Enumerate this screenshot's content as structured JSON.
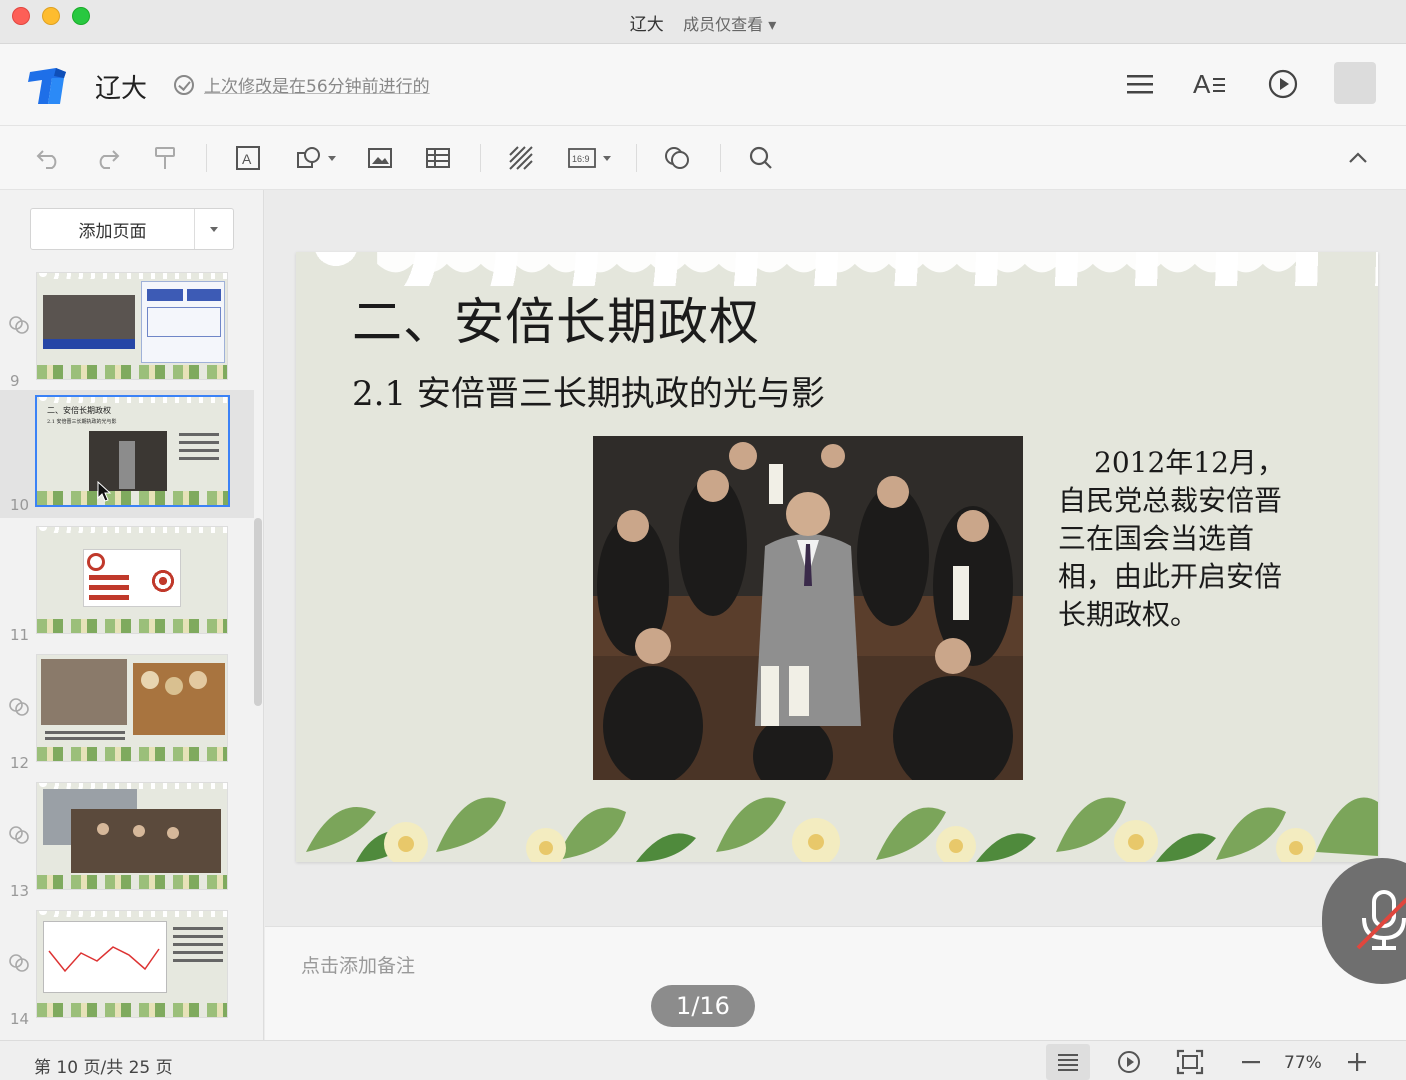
{
  "window": {
    "title": "辽大",
    "permission": "成员仅查看"
  },
  "header": {
    "doc_title": "辽大",
    "saved_status": "上次修改是在56分钟前进行的"
  },
  "sidebar": {
    "add_page": "添加页面",
    "thumbnails": [
      {
        "number": "9",
        "title": ""
      },
      {
        "number": "10",
        "title": "二、安倍长期政权",
        "subtitle": "2.1 安倍晋三长期执政的光与影"
      },
      {
        "number": "11",
        "title": ""
      },
      {
        "number": "12",
        "title": ""
      },
      {
        "number": "13",
        "title": ""
      },
      {
        "number": "14",
        "title": ""
      }
    ]
  },
  "slide": {
    "title": "二、安倍长期政权",
    "subtitle": "2.1 安倍晋三长期执政的光与影",
    "body": "2012年12月，自民党总裁安倍晋三在国会当选首相，由此开启安倍长期政权。"
  },
  "notes": {
    "placeholder": "点击添加备注"
  },
  "pager": {
    "text": "1/16"
  },
  "status": {
    "page_info": "第 10 页/共 25 页",
    "zoom": "77%"
  },
  "colors": {
    "accent": "#3b82f6",
    "logo_blue": "#1e6fe8",
    "slide_bg": "#e4e6dc"
  }
}
